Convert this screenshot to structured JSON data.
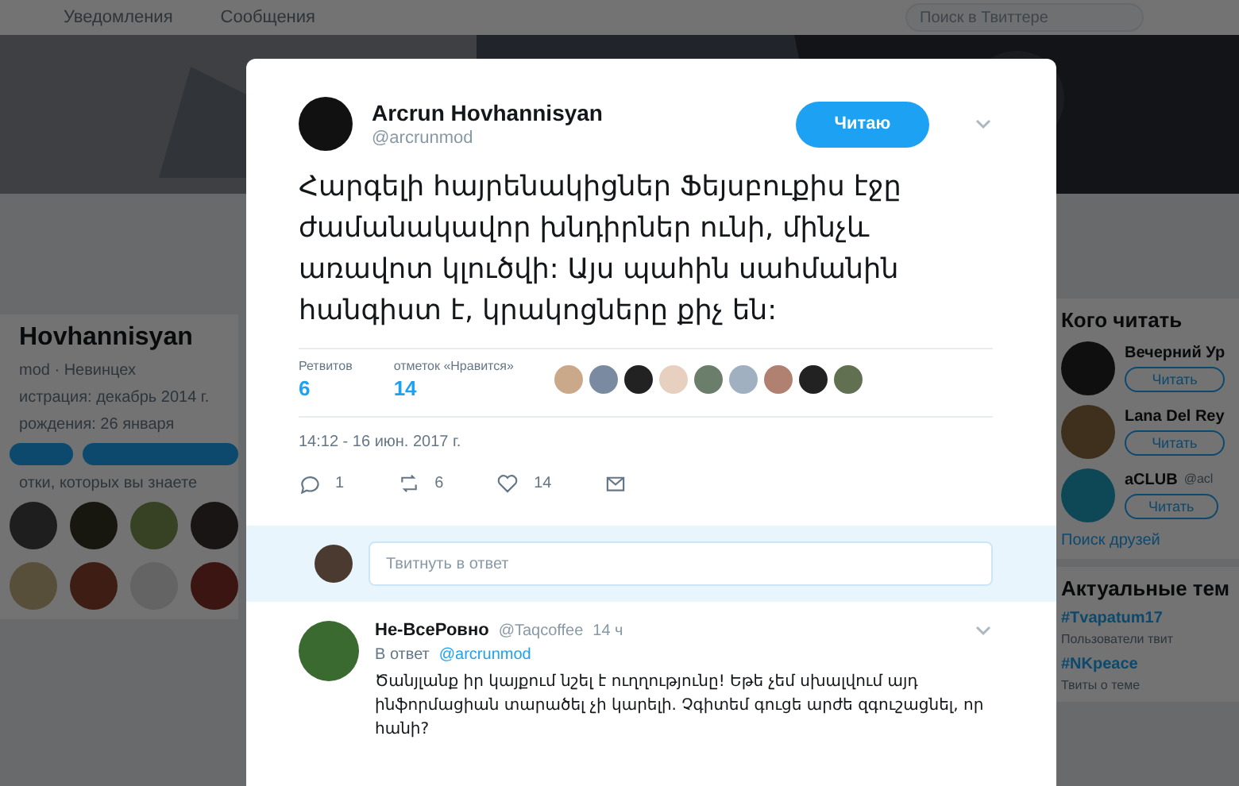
{
  "top_bar": {
    "items": [
      {
        "label": "Уведомления"
      },
      {
        "label": "Сообщения"
      }
    ],
    "search": {
      "placeholder": "Поиск в Твиттере"
    }
  },
  "profile": {
    "name": "Hovhannisyan",
    "handle": "mod · Невинцех",
    "joined": "истрация: декабрь 2014 г.",
    "birthday": "рождения: 26 января",
    "followers_known": "отки, которых вы знаете"
  },
  "who_to_follow": {
    "title": "Кого читать",
    "accounts": [
      {
        "name": "Вечерний Ур",
        "button": "Читать"
      },
      {
        "name": "Lana Del Rey",
        "button": "Читать"
      },
      {
        "name": "aCLUB",
        "handle": "@acl",
        "button": "Читать"
      }
    ],
    "find_friends": "Поиск друзей"
  },
  "trends": {
    "title": "Актуальные тем",
    "items": [
      {
        "tag": "#Tvapatum17",
        "note": "Пользователи твит"
      },
      {
        "tag": "#NKpeace",
        "note": "Твиты о теме"
      }
    ]
  },
  "tweet": {
    "author": "Arcrun Hovhannisyan",
    "handle": "@arcrunmod",
    "follow_button": "Читаю",
    "text": "Հարգելի հայրենակիցներ Ֆեյսբուքիս էջը ժամանակավոր խնդիրներ ունի, մինչև առավոտ կլուծվի: Այս պահին սահմանին հանգիստ է, կրակոցները քիչ են:",
    "retweets_label": "Ретвитов",
    "retweets": "6",
    "likes_label": "отметок «Нравится»",
    "likes": "14",
    "date": "14:12 - 16 июн. 2017 г.",
    "actions": [
      {
        "kind": "reply",
        "count": "1"
      },
      {
        "kind": "retweet",
        "count": "6"
      },
      {
        "kind": "like",
        "count": "14"
      },
      {
        "kind": "message"
      }
    ]
  },
  "reply_field": {
    "placeholder": "Твитнуть в ответ"
  },
  "reply": {
    "author": "Не-ВсеРовно",
    "handle": "@Taqcoffee",
    "time": "14 ч",
    "in_reply_label": "В ответ",
    "in_reply_to": "@arcrunmod",
    "text": "Ծանյլանք իր կայքում նշել է ուղղությունը! Եթե չեմ սխալվում այդ ինֆորմացիան տարածել չի կարելի. Չգիտեմ գուցե արժե զգուշացնել, որ հանի?"
  }
}
